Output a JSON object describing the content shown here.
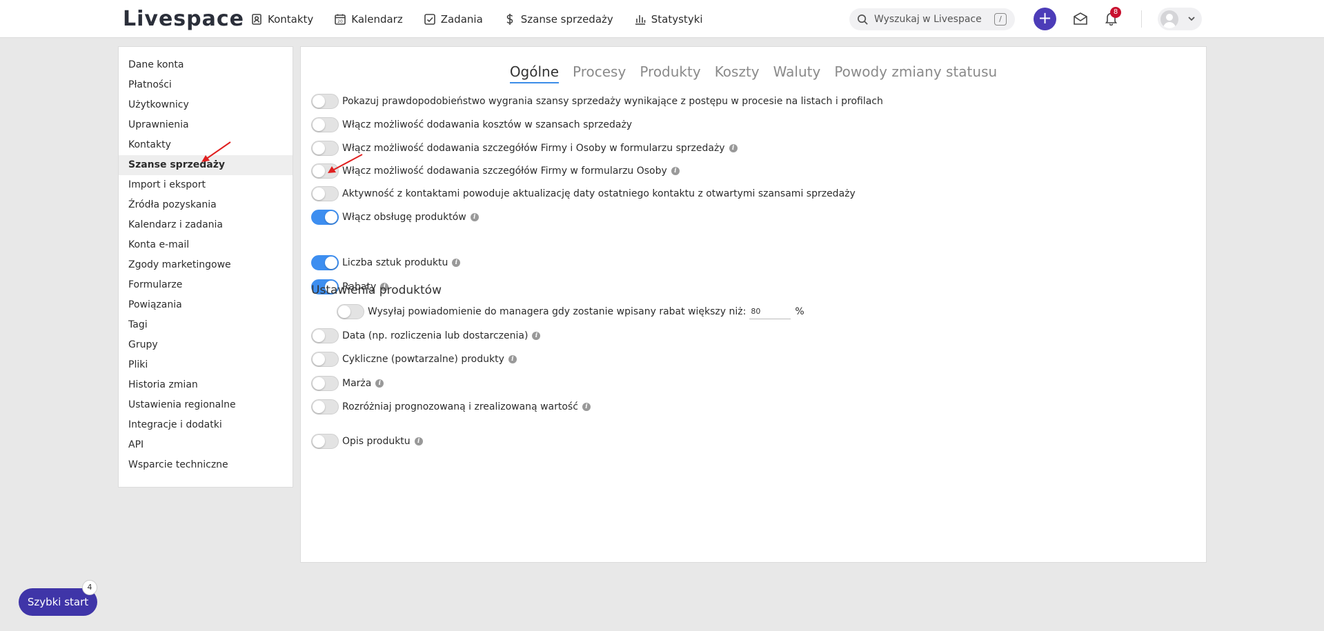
{
  "app": {
    "logo": "Livespace"
  },
  "nav": [
    {
      "label": "Kontakty",
      "icon": "contacts-icon"
    },
    {
      "label": "Kalendarz",
      "icon": "calendar-icon"
    },
    {
      "label": "Zadania",
      "icon": "tasks-icon"
    },
    {
      "label": "Szanse sprzedaży",
      "icon": "dollar-icon"
    },
    {
      "label": "Statystyki",
      "icon": "stats-icon"
    }
  ],
  "calendar_day": "20",
  "search": {
    "placeholder": "Wyszukaj w Livespace",
    "shortcut": "/"
  },
  "notifications": {
    "count": "8"
  },
  "sidebar": {
    "items": [
      "Dane konta",
      "Płatności",
      "Użytkownicy",
      "Uprawnienia",
      "Kontakty",
      "Szanse sprzedaży",
      "Import i eksport",
      "Źródła pozyskania",
      "Kalendarz i zadania",
      "Konta e-mail",
      "Zgody marketingowe",
      "Formularze",
      "Powiązania",
      "Tagi",
      "Grupy",
      "Pliki",
      "Historia zmian",
      "Ustawienia regionalne",
      "Integracje i dodatki",
      "API",
      "Wsparcie techniczne"
    ],
    "active": "Szanse sprzedaży"
  },
  "tabs": [
    "Ogólne",
    "Procesy",
    "Produkty",
    "Koszty",
    "Waluty",
    "Powody zmiany statusu"
  ],
  "settings": [
    {
      "label": "Pokazuj prawdopodobieństwo wygrania szansy sprzedaży wynikające z postępu w procesie na listach i profilach",
      "on": false,
      "info": false
    },
    {
      "label": "Włącz możliwość dodawania kosztów w szansach sprzedaży",
      "on": false,
      "info": false
    },
    {
      "label": "Włącz możliwość dodawania szczegółów Firmy i Osoby w formularzu sprzedaży",
      "on": false,
      "info": true
    },
    {
      "label": "Włącz możliwość dodawania szczegółów Firmy w formularzu Osoby",
      "on": false,
      "info": true
    },
    {
      "label": "Aktywność z kontaktami powoduje aktualizację daty ostatniego kontaktu z otwartymi szansami sprzedaży",
      "on": false,
      "info": false
    },
    {
      "label": "Włącz obsługę produktów",
      "on": true,
      "info": true
    }
  ],
  "product_settings": {
    "title": "Ustawienia produktów",
    "items": [
      {
        "label": "Liczba sztuk produktu",
        "on": true,
        "info": true
      },
      {
        "label": "Rabaty",
        "on": true,
        "info": true
      },
      {
        "label": "Wysyłaj powiadomienie do managera gdy zostanie wpisany rabat większy niż:",
        "on": false,
        "info": false,
        "value": "80",
        "unit": "%"
      },
      {
        "label": "Data (np. rozliczenia lub dostarczenia)",
        "on": false,
        "info": true
      },
      {
        "label": "Cykliczne (powtarzalne) produkty",
        "on": false,
        "info": true
      },
      {
        "label": "Marża",
        "on": false,
        "info": true
      },
      {
        "label": "Rozróżniaj prognozowaną i zrealizowaną wartość",
        "on": false,
        "info": true
      },
      {
        "label": "Opis produktu",
        "on": false,
        "info": true
      }
    ]
  },
  "quick_start": {
    "label": "Szybki start",
    "badge": "4"
  },
  "info_glyph": "i",
  "colors": {
    "accent": "#3d8ef0",
    "brand": "#4c3cb8",
    "badge": "#c8102e",
    "arrow": "#e02020"
  }
}
